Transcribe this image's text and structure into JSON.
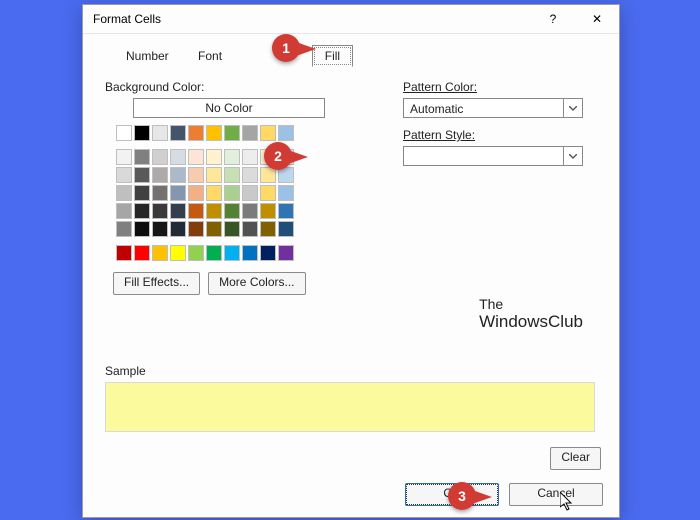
{
  "window": {
    "title": "Format Cells"
  },
  "tabs": {
    "number": "Number",
    "font": "Font",
    "fill": "Fill"
  },
  "labels": {
    "background_color": "Background Color:",
    "no_color": "No Color",
    "fill_effects": "Fill Effects...",
    "more_colors": "More Colors...",
    "pattern_color": "Pattern Color:",
    "pattern_style": "Pattern Style:",
    "automatic": "Automatic",
    "sample": "Sample",
    "clear": "Clear",
    "ok": "OK",
    "cancel": "Cancel"
  },
  "logo": {
    "line1": "The",
    "line2": "WindowsClub"
  },
  "callouts": {
    "one": "1",
    "two": "2",
    "three": "3"
  },
  "colors": {
    "accent": "#4a6bf0",
    "sample": "#fbfb9d",
    "theme_header": [
      "#ffffff",
      "#000000",
      "#e7e6e6",
      "#44546a",
      "#ed7d31",
      "#ffc000",
      "#70ad47",
      "#a5a5a5",
      "#ffd966",
      "#9bc2e6"
    ],
    "theme_grid": [
      [
        "#f2f2f2",
        "#808080",
        "#d0cece",
        "#d6dce4",
        "#fce4d6",
        "#fff2cc",
        "#e2efda",
        "#ededed",
        "#fff2cc",
        "#ddebf7"
      ],
      [
        "#d9d9d9",
        "#595959",
        "#aeaaaa",
        "#acb9ca",
        "#f8cbad",
        "#ffe699",
        "#c6e0b4",
        "#dbdbdb",
        "#ffe699",
        "#bdd7ee"
      ],
      [
        "#bfbfbf",
        "#404040",
        "#757171",
        "#8497b0",
        "#f4b084",
        "#ffd966",
        "#a9d08e",
        "#c9c9c9",
        "#ffd966",
        "#9bc2e6"
      ],
      [
        "#a6a6a6",
        "#262626",
        "#3a3838",
        "#333f4f",
        "#c65911",
        "#bf8f00",
        "#548235",
        "#7b7b7b",
        "#bf8f00",
        "#2f75b5"
      ],
      [
        "#808080",
        "#0d0d0d",
        "#161616",
        "#222b35",
        "#833c0c",
        "#806000",
        "#375623",
        "#525252",
        "#806000",
        "#1f4e78"
      ]
    ],
    "standard": [
      "#c00000",
      "#ff0000",
      "#ffc000",
      "#ffff00",
      "#92d050",
      "#00b050",
      "#00b0f0",
      "#0070c0",
      "#002060",
      "#7030a0"
    ]
  }
}
